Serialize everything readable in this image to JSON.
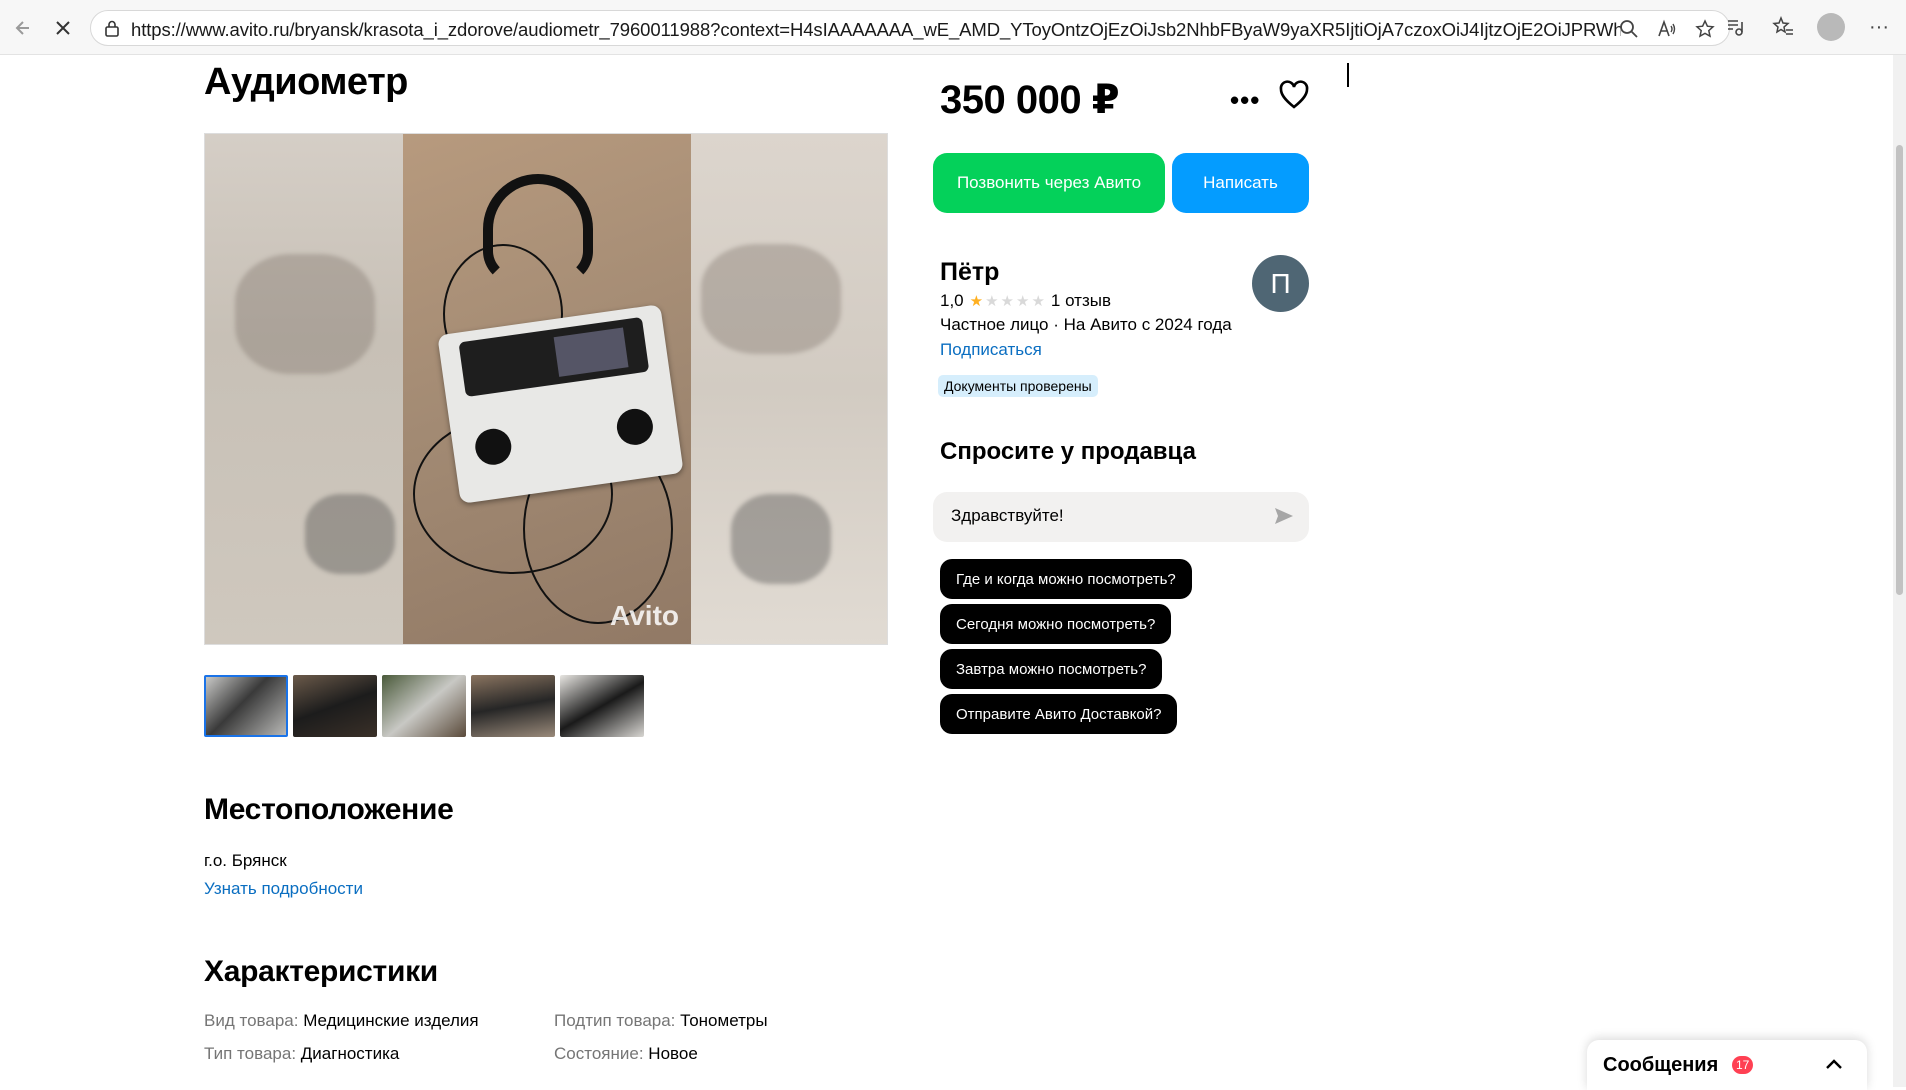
{
  "browser": {
    "url": "https://www.avito.ru/bryansk/krasota_i_zdorove/audiometr_7960011988?context=H4sIAAAAAAA_wE_AMD_YToyOntzOjEzOiJsb2NhbFByaW9yaXR5IjtiOjA7czoxOiJ4IjtzOjE2OiJPRWhQdm5yZz..."
  },
  "listing": {
    "title": "Аудиометр",
    "price": "350 000 ₽",
    "watermark": "Avito"
  },
  "actions": {
    "call_label": "Позвонить через Авито",
    "write_label": "Написать"
  },
  "seller": {
    "name": "Пётр",
    "avatar_letter": "П",
    "rating": "1,0",
    "rating_value": 1,
    "rating_max": 5,
    "reviews": "1 отзыв",
    "meta": "Частное лицо · На Авито с 2024 года",
    "subscribe_label": "Подписаться",
    "badge": "Документы проверены"
  },
  "ask": {
    "title": "Спросите у продавца",
    "input_value": "Здравствуйте!",
    "chips": [
      "Где и когда можно посмотреть?",
      "Сегодня можно посмотреть?",
      "Завтра можно посмотреть?",
      "Отправите Авито Доставкой?"
    ]
  },
  "location": {
    "title": "Местоположение",
    "address": "г.о. Брянск",
    "more_link": "Узнать подробности"
  },
  "characteristics": {
    "title": "Характеристики",
    "items": [
      {
        "key": "Вид товара:",
        "value": "Медицинские изделия"
      },
      {
        "key": "Подтип товара:",
        "value": "Тонометры"
      },
      {
        "key": "Тип товара:",
        "value": "Диагностика"
      },
      {
        "key": "Состояние:",
        "value": "Новое"
      }
    ]
  },
  "messages": {
    "label": "Сообщения",
    "count": "17"
  },
  "colors": {
    "call_button": "#04d15a",
    "write_button": "#049cff",
    "link": "#0a6ec1",
    "badge_bg": "#d6eefc",
    "star": "#ffb021",
    "messages_badge": "#ff4053"
  }
}
